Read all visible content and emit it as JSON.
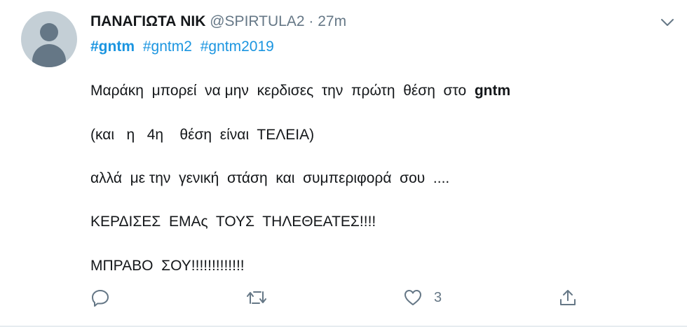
{
  "author": {
    "display_name": "ΠΑΝΑΓΙΩΤΑ ΝΙΚ",
    "handle": "@SPIRTULA2",
    "separator": "·",
    "time": "27m"
  },
  "hashtags": [
    "#gntm",
    "#gntm2",
    "#gntm2019"
  ],
  "body": {
    "line1_text": "Μαράκη  μπορεί  να μην  κερδισες  την  πρώτη  θέση  στο  ",
    "line1_bold": "gntm",
    "line2": "(και   η   4η    θέση  είναι  ΤΕΛΕΙΑ)",
    "line3": "αλλά  με την  γενική  στάση  και  συμπεριφορά  σου  ....",
    "line4": "ΚΕΡΔΙΣΕΣ  ΕΜΑς  ΤΟΥΣ  ΤΗΛΕΘΕΑΤΕΣ!!!!",
    "line5": "ΜΠΡΑΒΟ  ΣΟΥ!!!!!!!!!!!!!"
  },
  "actions": {
    "like_count": "3",
    "icons": [
      "reply-icon",
      "retweet-icon",
      "like-icon",
      "share-icon"
    ]
  },
  "colors": {
    "link": "#1b95e0",
    "secondary": "#657786",
    "icon": "#657786",
    "divider": "#e6ecf0"
  }
}
